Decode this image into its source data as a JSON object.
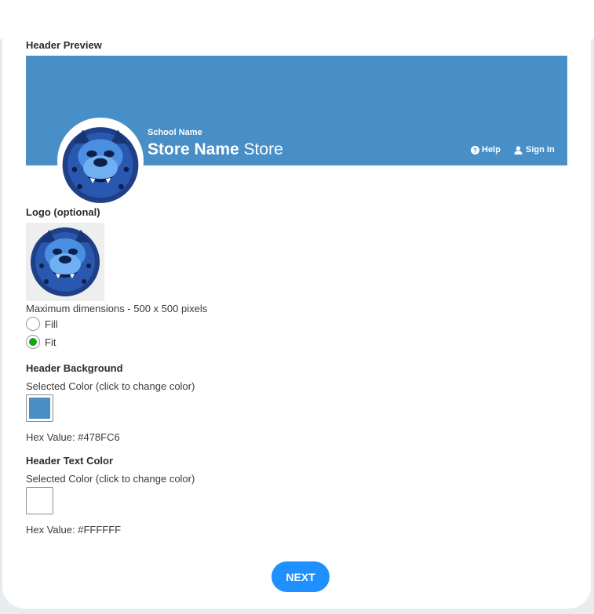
{
  "colors": {
    "header_background": "#478FC6",
    "header_text": "#FFFFFF",
    "next_button": "#1E90FF",
    "radio_selected": "#18A218"
  },
  "header_preview": {
    "title": "Header Preview",
    "school_name": "School Name",
    "store_name_bold": "Store Name",
    "store_suffix": " Store",
    "help_label": "Help",
    "signin_label": "Sign In",
    "help_icon": "question-circle-icon",
    "signin_icon": "user-icon",
    "logo_icon": "bulldog-mascot-logo"
  },
  "logo": {
    "title": "Logo (optional)",
    "max_dimensions": "Maximum dimensions - 500 x 500 pixels",
    "options": [
      {
        "label": "Fill",
        "selected": false
      },
      {
        "label": "Fit",
        "selected": true
      }
    ]
  },
  "header_background": {
    "title": "Header Background",
    "instruction": "Selected Color (click to change color)",
    "hex_label": "Hex Value: #478FC6"
  },
  "header_text_color": {
    "title": "Header Text Color",
    "instruction": "Selected Color (click to change color)",
    "hex_label": "Hex Value: #FFFFFF"
  },
  "next_button": {
    "label": "NEXT"
  }
}
